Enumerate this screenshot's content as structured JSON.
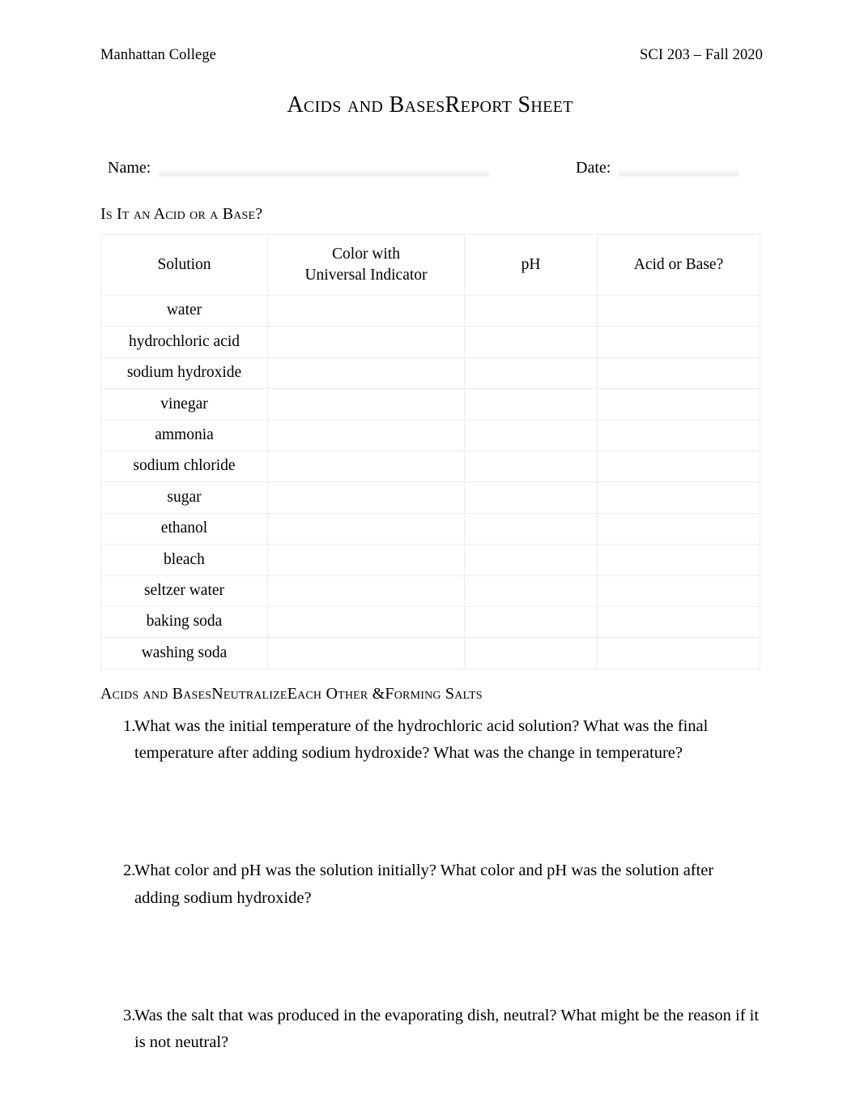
{
  "header": {
    "institution": "Manhattan College",
    "course": "SCI 203 – Fall 2020"
  },
  "title": "Acids and BasesReport Sheet",
  "fields": {
    "name_label": "Name:",
    "name_value": "",
    "date_label": "Date:",
    "date_value": ""
  },
  "sections": {
    "section1_heading": "Is It an Acid or a Base?",
    "section2_heading": "Acids and BasesNeutralizeEach Other &Forming Salts"
  },
  "table": {
    "columns": [
      {
        "key": "solution",
        "label": "Solution",
        "label_line2": ""
      },
      {
        "key": "color",
        "label": "Color with",
        "label_line2": "Universal Indicator"
      },
      {
        "key": "ph",
        "label": "pH",
        "label_line2": ""
      },
      {
        "key": "acid_or_base",
        "label": "Acid or Base?",
        "label_line2": ""
      }
    ],
    "rows": [
      {
        "solution": "water",
        "color": "",
        "ph": "",
        "acid_or_base": ""
      },
      {
        "solution": "hydrochloric acid",
        "color": "",
        "ph": "",
        "acid_or_base": ""
      },
      {
        "solution": "sodium hydroxide",
        "color": "",
        "ph": "",
        "acid_or_base": ""
      },
      {
        "solution": "vinegar",
        "color": "",
        "ph": "",
        "acid_or_base": ""
      },
      {
        "solution": "ammonia",
        "color": "",
        "ph": "",
        "acid_or_base": ""
      },
      {
        "solution": "sodium chloride",
        "color": "",
        "ph": "",
        "acid_or_base": ""
      },
      {
        "solution": "sugar",
        "color": "",
        "ph": "",
        "acid_or_base": ""
      },
      {
        "solution": "ethanol",
        "color": "",
        "ph": "",
        "acid_or_base": ""
      },
      {
        "solution": "bleach",
        "color": "",
        "ph": "",
        "acid_or_base": ""
      },
      {
        "solution": "seltzer water",
        "color": "",
        "ph": "",
        "acid_or_base": ""
      },
      {
        "solution": "baking soda",
        "color": "",
        "ph": "",
        "acid_or_base": ""
      },
      {
        "solution": "washing soda",
        "color": "",
        "ph": "",
        "acid_or_base": ""
      }
    ]
  },
  "questions": [
    {
      "number": "1.",
      "text": "What was the initial temperature of the hydrochloric acid solution? What was the final temperature after adding sodium hydroxide? What was the change in temperature?"
    },
    {
      "number": "2.",
      "text": "What color and pH was the solution initially? What color and pH was the solution after adding sodium hydroxide?"
    },
    {
      "number": "3.",
      "text": "Was the salt that was produced in the evaporating dish, neutral? What might be the reason if it is not neutral?"
    }
  ],
  "colors": {
    "text": "#000000",
    "page_background": "#ffffff",
    "table_border": "#eceded",
    "fill_line": "#f1f1f2"
  }
}
